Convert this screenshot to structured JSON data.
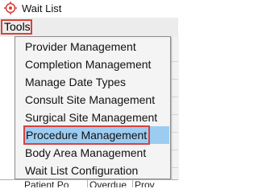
{
  "window": {
    "title": "Wait List",
    "icon": "target-icon",
    "accent_color": "#d9413c"
  },
  "menubar": {
    "tools_label": "Tools"
  },
  "tools_menu": {
    "items": [
      {
        "label": "Provider Management"
      },
      {
        "label": "Completion Management"
      },
      {
        "label": "Manage Date Types"
      },
      {
        "label": "Consult Site Management"
      },
      {
        "label": "Surgical Site Management"
      },
      {
        "label": "Procedure Management",
        "highlighted": true
      },
      {
        "label": "Body Area Management"
      },
      {
        "label": "Wait List Configuration"
      }
    ],
    "highlight_color": "#9cccf2"
  },
  "table": {
    "columns": [
      {
        "label": "Patient Po"
      },
      {
        "label": "Overdue"
      },
      {
        "label": "Prov"
      }
    ]
  }
}
